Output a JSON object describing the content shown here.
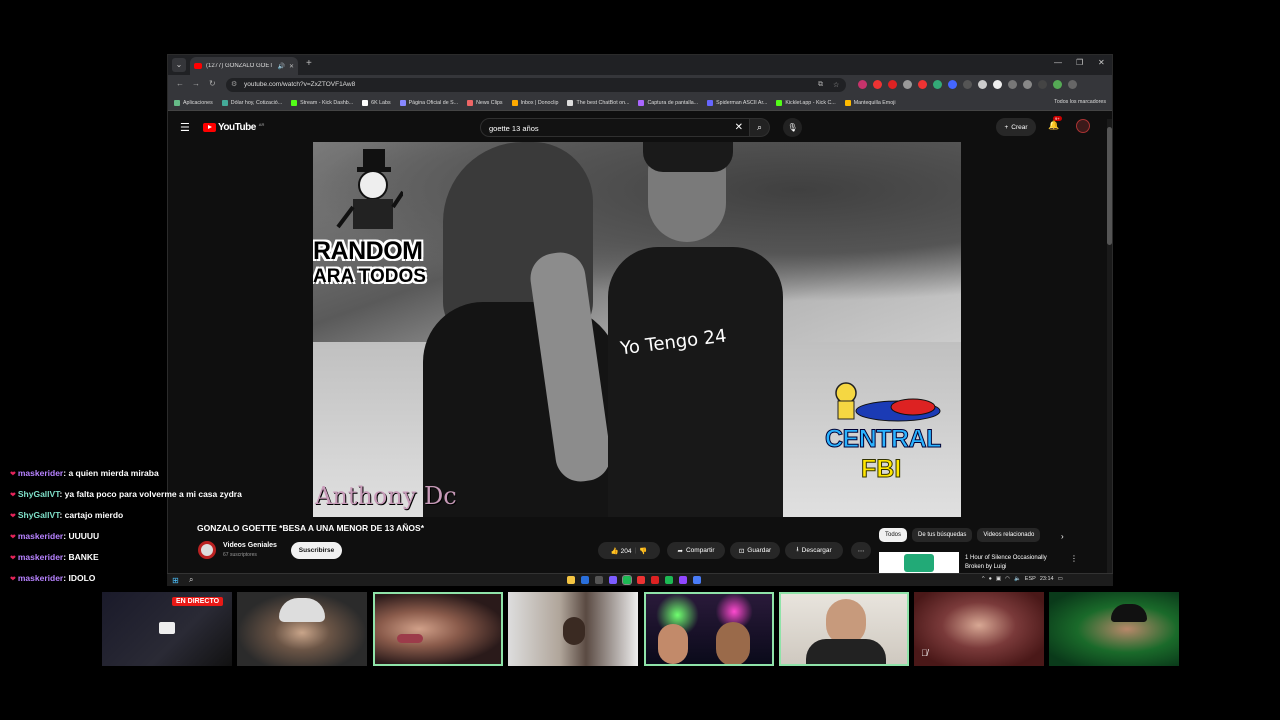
{
  "browser": {
    "tab_title": "(1277) GONZALO GOETTE",
    "url": "youtube.com/watch?v=ZxZTOVF1Aw8",
    "bookmarks": [
      "Aplicaciones",
      "Dólar hoy, Cotizació...",
      "Stream - Kick Dashb...",
      "6K Labs",
      "Página Oficial de S...",
      "News Clips",
      "Inbox | Donoclip",
      "The best ChatBot on...",
      "Captura de pantalla...",
      "Spiderman ASCII Ar...",
      "Kicklet.app - Kick C...",
      "Mantequilla Emoji"
    ],
    "bookmarks_all": "Todos los marcadores"
  },
  "youtube": {
    "logo": "YouTube",
    "logo_region": "AR",
    "search_query": "goette 13 años",
    "create_label": "Crear",
    "notif_badge": "9+",
    "video_overlays": {
      "random": "RANDOM",
      "todos": "ARA TODOS",
      "shirt": "Yo Tengo 24",
      "central": "CENTRAL",
      "fbi": "FBI",
      "watermark": "Anthony Dc"
    },
    "video_title": "GONZALO GOETTE *BESA A UNA MENOR DE 13 AÑOS*",
    "channel_name": "Videos Geniales",
    "channel_subs": "67 suscriptores",
    "subscribe_label": "Suscribirse",
    "likes": "204",
    "share_label": "Compartir",
    "save_label": "Guardar",
    "download_label": "Descargar",
    "chips": [
      "Todos",
      "De tus búsquedas",
      "Videos relacionado"
    ],
    "rec_title": "1 Hour of Silence Occasionally Broken by Luigi"
  },
  "taskbar": {
    "lang": "ESP",
    "time": "23:14"
  },
  "chat": [
    {
      "user": "maskerider",
      "color": "#b782ff",
      "msg": "a quien mierda miraba"
    },
    {
      "user": "ShyGallVT",
      "color": "#7fe0c9",
      "msg": "ya falta poco para volverme a mi casa zydra"
    },
    {
      "user": "ShyGallVT",
      "color": "#7fe0c9",
      "msg": "cartajo mierdo"
    },
    {
      "user": "maskerider",
      "color": "#b782ff",
      "msg": "UUUUU"
    },
    {
      "user": "maskerider",
      "color": "#b782ff",
      "msg": "BANKE"
    },
    {
      "user": "maskerider",
      "color": "#b782ff",
      "msg": "IDOLO"
    }
  ],
  "live_badge": "EN DIRECTO",
  "colors": {
    "yt_red": "#ff0000",
    "live_red": "#e91916",
    "cam_highlight": "#8fe3a9"
  }
}
